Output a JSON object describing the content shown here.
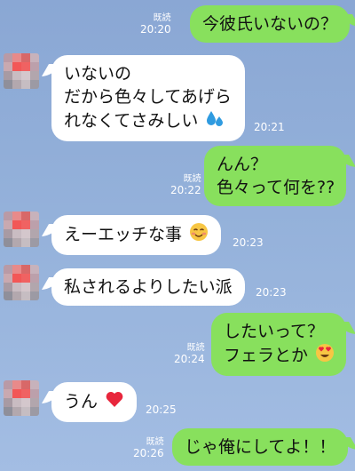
{
  "colors": {
    "background": "#94b1da",
    "incoming_bubble": "#ffffff",
    "outgoing_bubble": "#88e05d",
    "meta_text": "#ffffff"
  },
  "messages": [
    {
      "dir": "out",
      "lines": [
        "今彼氏いないの？"
      ],
      "read": "既読",
      "time": "20:20"
    },
    {
      "dir": "in",
      "lines": [
        "いないの",
        "だから色々してあげら",
        "れなくてさみしい"
      ],
      "emoji": "sweat-droplets-icon",
      "time": "20:21"
    },
    {
      "dir": "out",
      "lines": [
        "んん？",
        "色々って何を??"
      ],
      "read": "既読",
      "time": "20:22"
    },
    {
      "dir": "in",
      "lines": [
        "えーエッチな事"
      ],
      "emoji": "smiling-face-icon",
      "time": "20:23"
    },
    {
      "dir": "in",
      "lines": [
        "私されるよりしたい派"
      ],
      "time": "20:23"
    },
    {
      "dir": "out",
      "lines": [
        "したいって？",
        "フェラとか"
      ],
      "emoji": "heart-eyes-icon",
      "read": "既読",
      "time": "20:24"
    },
    {
      "dir": "in",
      "lines": [
        "うん"
      ],
      "emoji": "red-heart-icon",
      "time": "20:25"
    },
    {
      "dir": "out",
      "lines": [
        "じゃ俺にしてよ！！"
      ],
      "read": "既読",
      "time": "20:26"
    }
  ]
}
